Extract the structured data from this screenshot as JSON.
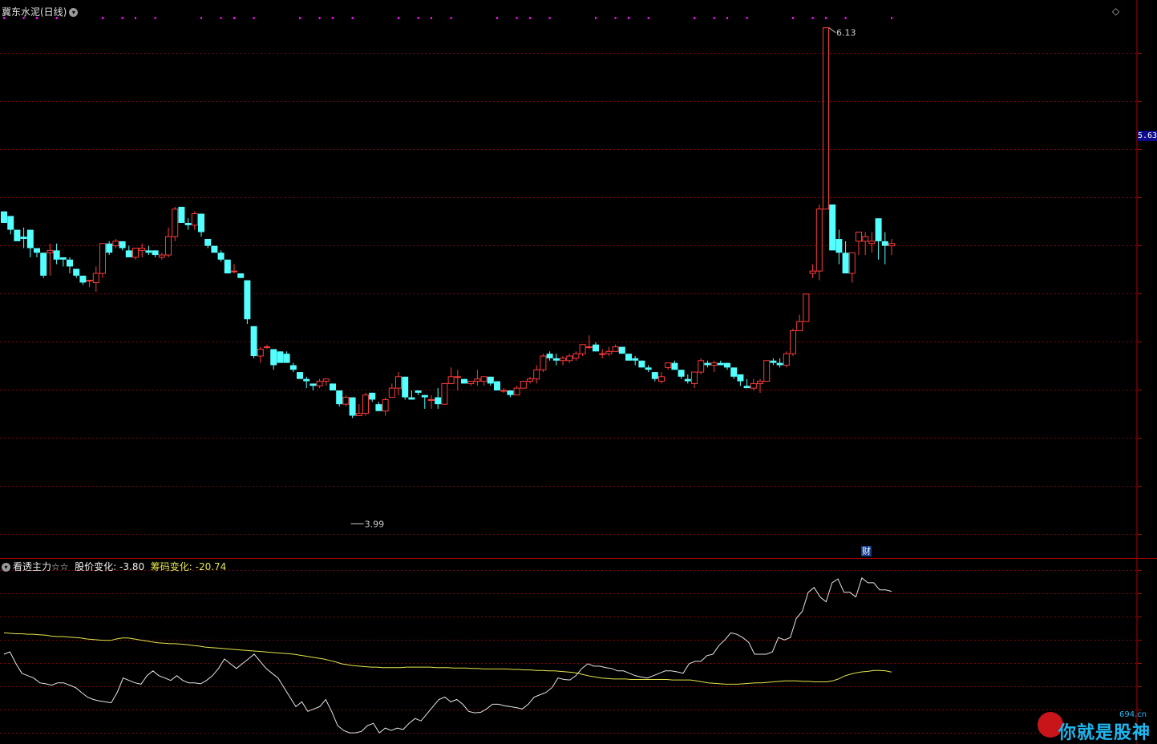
{
  "window": {
    "title": "冀东水泥(日线)",
    "collapse_icon": "chevron-down-icon",
    "diamond_icon": "diamond-icon"
  },
  "price_tag": "5.63",
  "annotations": {
    "high_label": "6.13",
    "low_label": "3.99",
    "cai_badge": "财"
  },
  "indicator": {
    "name": "看透主力☆☆",
    "price_change_label": "股价变化:",
    "price_change_value": "-3.80",
    "chip_change_label": "筹码变化:",
    "chip_change_value": "-20.74"
  },
  "watermark": {
    "text": "你就是股神",
    "url": "694.cn"
  },
  "colors": {
    "up": "#ff3b3b",
    "down": "#54ffff",
    "grid": "#8b0000",
    "line_white": "#e6e6e6",
    "line_yellow": "#e6e64c",
    "marker": "#ff00ff"
  },
  "chart_data": [
    {
      "type": "candlestick",
      "title": "冀东水泥(日线)",
      "y_range": [
        3.82,
        6.23
      ],
      "marked_high": 6.13,
      "marked_low": 3.99,
      "candles": [
        [
          5.33,
          5.28,
          5.33,
          5.31
        ],
        [
          5.31,
          5.25,
          5.31,
          5.23
        ],
        [
          5.25,
          5.2,
          5.24,
          5.23
        ],
        [
          5.22,
          5.21,
          5.26,
          5.17
        ],
        [
          5.25,
          5.17,
          5.25,
          5.13
        ],
        [
          5.17,
          5.15,
          5.17,
          5.13
        ],
        [
          5.15,
          5.05,
          5.15,
          5.04
        ],
        [
          5.15,
          5.16,
          5.19,
          5.05
        ],
        [
          5.16,
          5.12,
          5.19,
          5.1
        ],
        [
          5.13,
          5.12,
          5.13,
          5.09
        ],
        [
          5.12,
          5.09,
          5.13,
          5.06
        ],
        [
          5.08,
          5.05,
          5.08,
          5.04
        ],
        [
          5.05,
          5.02,
          5.05,
          5.01
        ],
        [
          5.03,
          5.03,
          5.03,
          5.0
        ],
        [
          5.02,
          5.06,
          5.09,
          4.98
        ],
        [
          5.06,
          5.19,
          5.19,
          5.04
        ],
        [
          5.19,
          5.15,
          5.2,
          5.14
        ],
        [
          5.18,
          5.2,
          5.21,
          5.17
        ],
        [
          5.2,
          5.17,
          5.2,
          5.16
        ],
        [
          5.16,
          5.13,
          5.18,
          5.13
        ],
        [
          5.13,
          5.17,
          5.17,
          5.12
        ],
        [
          5.16,
          5.17,
          5.19,
          5.13
        ],
        [
          5.16,
          5.15,
          5.18,
          5.14
        ],
        [
          5.16,
          5.14,
          5.16,
          5.13
        ],
        [
          5.13,
          5.14,
          5.15,
          5.12
        ],
        [
          5.14,
          5.22,
          5.26,
          5.13
        ],
        [
          5.22,
          5.34,
          5.35,
          5.2
        ],
        [
          5.35,
          5.28,
          5.35,
          5.28
        ],
        [
          5.28,
          5.27,
          5.3,
          5.25
        ],
        [
          5.27,
          5.32,
          5.33,
          5.25
        ],
        [
          5.32,
          5.24,
          5.32,
          5.22
        ],
        [
          5.21,
          5.18,
          5.21,
          5.17
        ],
        [
          5.18,
          5.15,
          5.18,
          5.15
        ],
        [
          5.15,
          5.12,
          5.16,
          5.11
        ],
        [
          5.12,
          5.06,
          5.12,
          5.06
        ],
        [
          5.07,
          5.07,
          5.1,
          5.06
        ],
        [
          5.06,
          5.04,
          5.06,
          5.04
        ],
        [
          5.03,
          4.86,
          5.03,
          4.84
        ],
        [
          4.83,
          4.7,
          4.83,
          4.69
        ],
        [
          4.7,
          4.73,
          4.74,
          4.67
        ],
        [
          4.74,
          4.74,
          4.75,
          4.73
        ],
        [
          4.73,
          4.66,
          4.73,
          4.64
        ],
        [
          4.72,
          4.67,
          4.72,
          4.67
        ],
        [
          4.71,
          4.67,
          4.72,
          4.67
        ],
        [
          4.66,
          4.64,
          4.67,
          4.63
        ],
        [
          4.63,
          4.6,
          4.63,
          4.6
        ],
        [
          4.6,
          4.59,
          4.61,
          4.56
        ],
        [
          4.58,
          4.57,
          4.58,
          4.55
        ],
        [
          4.57,
          4.59,
          4.6,
          4.56
        ],
        [
          4.59,
          4.6,
          4.6,
          4.57
        ],
        [
          4.58,
          4.55,
          4.58,
          4.55
        ],
        [
          4.55,
          4.49,
          4.55,
          4.48
        ],
        [
          4.49,
          4.52,
          4.53,
          4.48
        ],
        [
          4.52,
          4.44,
          4.52,
          4.43
        ],
        [
          4.44,
          4.45,
          4.49,
          4.44
        ],
        [
          4.45,
          4.53,
          4.54,
          4.44
        ],
        [
          4.54,
          4.51,
          4.54,
          4.5
        ],
        [
          4.49,
          4.46,
          4.5,
          4.46
        ],
        [
          4.46,
          4.51,
          4.52,
          4.44
        ],
        [
          4.52,
          4.56,
          4.58,
          4.52
        ],
        [
          4.56,
          4.61,
          4.63,
          4.53
        ],
        [
          4.61,
          4.52,
          4.61,
          4.51
        ],
        [
          4.52,
          4.51,
          4.55,
          4.51
        ],
        [
          4.55,
          4.54,
          4.55,
          4.53
        ],
        [
          4.53,
          4.52,
          4.53,
          4.47
        ],
        [
          4.51,
          4.51,
          4.53,
          4.47
        ],
        [
          4.52,
          4.49,
          4.56,
          4.47
        ],
        [
          4.49,
          4.58,
          4.58,
          4.49
        ],
        [
          4.58,
          4.61,
          4.65,
          4.58
        ],
        [
          4.61,
          4.61,
          4.64,
          4.55
        ],
        [
          4.6,
          4.58,
          4.6,
          4.58
        ],
        [
          4.58,
          4.59,
          4.59,
          4.57
        ],
        [
          4.59,
          4.6,
          4.64,
          4.57
        ],
        [
          4.59,
          4.61,
          4.61,
          4.57
        ],
        [
          4.61,
          4.58,
          4.61,
          4.57
        ],
        [
          4.59,
          4.55,
          4.59,
          4.55
        ],
        [
          4.55,
          4.55,
          4.56,
          4.54
        ],
        [
          4.55,
          4.53,
          4.55,
          4.52
        ],
        [
          4.53,
          4.56,
          4.57,
          4.53
        ],
        [
          4.56,
          4.59,
          4.59,
          4.56
        ],
        [
          4.59,
          4.6,
          4.61,
          4.58
        ],
        [
          4.6,
          4.64,
          4.66,
          4.58
        ],
        [
          4.64,
          4.7,
          4.71,
          4.63
        ],
        [
          4.71,
          4.69,
          4.72,
          4.68
        ],
        [
          4.69,
          4.68,
          4.71,
          4.66
        ],
        [
          4.68,
          4.69,
          4.7,
          4.66
        ],
        [
          4.68,
          4.7,
          4.71,
          4.67
        ],
        [
          4.69,
          4.71,
          4.72,
          4.68
        ],
        [
          4.71,
          4.75,
          4.75,
          4.7
        ],
        [
          4.74,
          4.74,
          4.79,
          4.73
        ],
        [
          4.75,
          4.72,
          4.76,
          4.72
        ],
        [
          4.71,
          4.71,
          4.73,
          4.69
        ],
        [
          4.71,
          4.72,
          4.74,
          4.7
        ],
        [
          4.72,
          4.74,
          4.75,
          4.72
        ],
        [
          4.74,
          4.71,
          4.74,
          4.71
        ],
        [
          4.71,
          4.68,
          4.71,
          4.68
        ],
        [
          4.69,
          4.68,
          4.7,
          4.66
        ],
        [
          4.68,
          4.65,
          4.68,
          4.65
        ],
        [
          4.65,
          4.64,
          4.66,
          4.63
        ],
        [
          4.63,
          4.6,
          4.63,
          4.59
        ],
        [
          4.59,
          4.61,
          4.63,
          4.58
        ],
        [
          4.65,
          4.67,
          4.67,
          4.64
        ],
        [
          4.67,
          4.64,
          4.68,
          4.64
        ],
        [
          4.64,
          4.61,
          4.64,
          4.6
        ],
        [
          4.6,
          4.59,
          4.62,
          4.58
        ],
        [
          4.58,
          4.63,
          4.63,
          4.56
        ],
        [
          4.63,
          4.68,
          4.69,
          4.62
        ],
        [
          4.67,
          4.66,
          4.68,
          4.65
        ],
        [
          4.66,
          4.67,
          4.68,
          4.63
        ],
        [
          4.67,
          4.66,
          4.68,
          4.66
        ],
        [
          4.67,
          4.65,
          4.67,
          4.64
        ],
        [
          4.65,
          4.61,
          4.65,
          4.6
        ],
        [
          4.62,
          4.59,
          4.62,
          4.57
        ],
        [
          4.57,
          4.56,
          4.6,
          4.56
        ],
        [
          4.56,
          4.58,
          4.6,
          4.55
        ],
        [
          4.58,
          4.59,
          4.6,
          4.54
        ],
        [
          4.59,
          4.68,
          4.68,
          4.59
        ],
        [
          4.68,
          4.67,
          4.69,
          4.66
        ],
        [
          4.67,
          4.66,
          4.69,
          4.65
        ],
        [
          4.66,
          4.71,
          4.72,
          4.65
        ],
        [
          4.71,
          4.81,
          4.82,
          4.7
        ],
        [
          4.81,
          4.85,
          4.88,
          4.81
        ],
        [
          4.85,
          4.97,
          4.97,
          4.85
        ],
        [
          5.06,
          5.07,
          5.1,
          5.04
        ],
        [
          5.07,
          5.34,
          5.36,
          5.03
        ],
        [
          5.34,
          6.13,
          6.13,
          5.34
        ],
        [
          5.36,
          5.16,
          5.36,
          5.16
        ],
        [
          5.21,
          5.15,
          5.25,
          5.1
        ],
        [
          5.15,
          5.06,
          5.2,
          5.06
        ],
        [
          5.06,
          5.15,
          5.15,
          5.02
        ],
        [
          5.2,
          5.24,
          5.24,
          5.14
        ],
        [
          5.2,
          5.22,
          5.24,
          5.14
        ],
        [
          5.19,
          5.2,
          5.24,
          5.15
        ],
        [
          5.3,
          5.2,
          5.3,
          5.12
        ],
        [
          5.2,
          5.18,
          5.24,
          5.1
        ],
        [
          5.18,
          5.19,
          5.21,
          5.14
        ]
      ]
    },
    {
      "type": "line",
      "title": "看透主力☆☆",
      "series": [
        {
          "name": "股价变化",
          "values": [
            -17,
            -16.5,
            -19,
            -21,
            -21.5,
            -22,
            -23,
            -23.2,
            -23.5,
            -23,
            -23,
            -23.5,
            -24,
            -25,
            -26,
            -26.5,
            -26.8,
            -27,
            -27.2,
            -25,
            -22,
            -22.5,
            -23,
            -23.3,
            -21.5,
            -20.5,
            -21.5,
            -22,
            -22.5,
            -21.5,
            -22.5,
            -23,
            -23,
            -23.2,
            -22.5,
            -21.5,
            -20,
            -18,
            -19,
            -20,
            -19,
            -18,
            -17,
            -18.5,
            -20,
            -21,
            -22,
            -24,
            -26,
            -28,
            -27,
            -29,
            -28.5,
            -28,
            -26.5,
            -29,
            -32,
            -33,
            -33.5,
            -33.5,
            -33.2,
            -32,
            -31.5,
            -33.5,
            -32.5,
            -33,
            -32.5,
            -32.8,
            -31.5,
            -30.5,
            -31,
            -29.5,
            -28,
            -26.5,
            -26,
            -27,
            -26.5,
            -27.5,
            -29,
            -29.3,
            -29.2,
            -28.5,
            -27.5,
            -27.5,
            -27.8,
            -28,
            -28.2,
            -28.5,
            -27.5,
            -26,
            -25.5,
            -25,
            -24,
            -22,
            -22.3,
            -22.4,
            -21.5,
            -20,
            -19,
            -19.5,
            -19.5,
            -19.8,
            -20,
            -20.5,
            -20.5,
            -21,
            -21.5,
            -21.8,
            -22,
            -21.5,
            -21,
            -20.5,
            -20.5,
            -20.7,
            -21,
            -19,
            -18.5,
            -18.5,
            -17.3,
            -17,
            -15.2,
            -14,
            -12.5,
            -12.8,
            -13.5,
            -14.5,
            -17,
            -17,
            -17,
            -16.5,
            -13.5,
            -14,
            -13.5,
            -9.5,
            -8,
            -4,
            -3,
            -5,
            -6,
            -2,
            -1.2,
            -4,
            -4,
            -5,
            -1,
            -2,
            -2,
            -3.5,
            -3.5,
            -3.8
          ]
        },
        {
          "name": "筹码变化",
          "values": [
            -12.5,
            -12.6,
            -12.7,
            -12.7,
            -12.8,
            -12.8,
            -12.9,
            -13.0,
            -13.2,
            -13.3,
            -13.3,
            -13.4,
            -13.5,
            -13.6,
            -13.8,
            -13.9,
            -14.0,
            -14.1,
            -14.1,
            -13.8,
            -13.6,
            -13.6,
            -13.8,
            -14.0,
            -14.2,
            -14.4,
            -14.6,
            -14.7,
            -14.8,
            -14.8,
            -14.9,
            -15.0,
            -15.2,
            -15.3,
            -15.5,
            -15.6,
            -15.7,
            -15.8,
            -15.9,
            -16.0,
            -16.1,
            -16.2,
            -16.3,
            -16.4,
            -16.5,
            -16.6,
            -16.7,
            -16.8,
            -16.9,
            -17.0,
            -17.2,
            -17.4,
            -17.6,
            -17.8,
            -18.0,
            -18.3,
            -18.6,
            -19.0,
            -19.2,
            -19.4,
            -19.5,
            -19.6,
            -19.7,
            -19.7,
            -19.8,
            -19.8,
            -19.8,
            -19.8,
            -19.7,
            -19.7,
            -19.7,
            -19.7,
            -19.7,
            -19.8,
            -19.8,
            -19.8,
            -19.9,
            -19.9,
            -19.9,
            -20.0,
            -20.0,
            -20.1,
            -20.1,
            -20.1,
            -20.1,
            -20.1,
            -20.2,
            -20.2,
            -20.3,
            -20.3,
            -20.4,
            -20.4,
            -20.5,
            -20.5,
            -20.6,
            -20.7,
            -20.8,
            -21.0,
            -21.3,
            -21.6,
            -21.8,
            -22.0,
            -22.1,
            -22.2,
            -22.2,
            -22.2,
            -22.3,
            -22.3,
            -22.3,
            -22.3,
            -22.3,
            -22.3,
            -22.3,
            -22.4,
            -22.4,
            -22.4,
            -22.4,
            -22.6,
            -22.8,
            -23.0,
            -23.1,
            -23.2,
            -23.3,
            -23.3,
            -23.3,
            -23.2,
            -23.1,
            -23.0,
            -23.0,
            -22.9,
            -22.8,
            -22.7,
            -22.6,
            -22.6,
            -22.6,
            -22.7,
            -22.7,
            -22.8,
            -22.8,
            -22.8,
            -22.6,
            -22.2,
            -21.6,
            -21.2,
            -20.9,
            -20.7,
            -20.6,
            -20.4,
            -20.4,
            -20.5,
            -20.74
          ]
        }
      ]
    }
  ]
}
